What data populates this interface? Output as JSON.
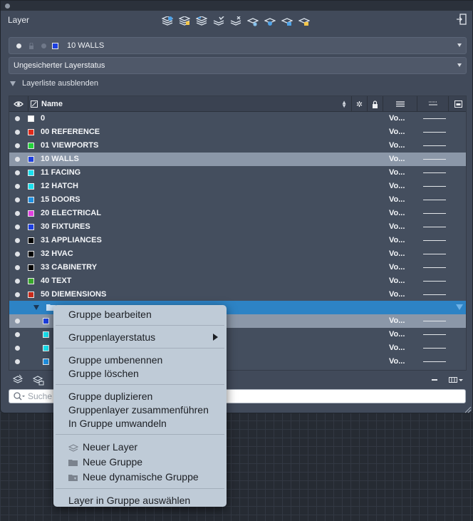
{
  "palette": {
    "title": "Layer",
    "toolbar_icons": [
      "new-layer-icon",
      "new-layer-vp-freeze-icon",
      "delete-layer-icon",
      "set-current-icon",
      "layer-states-icon",
      "freeze-icon",
      "isolate-icon",
      "lock-icon",
      "unlock-icon"
    ],
    "current_layer": "10 WALLS",
    "current_layer_color": "#1d3fe0",
    "layer_state": "Ungesicherter Layerstatus",
    "hide_list_label": "Layerliste ausblenden"
  },
  "table": {
    "header_name": "Name",
    "rows": [
      {
        "name": "0",
        "color": "#ffffff",
        "vo": "Vo..."
      },
      {
        "name": "00 REFERENCE",
        "color": "#e02a1a",
        "vo": "Vo..."
      },
      {
        "name": "01 VIEWPORTS",
        "color": "#22d43a",
        "vo": "Vo..."
      },
      {
        "name": "10 WALLS",
        "color": "#1d3fe0",
        "vo": "Vo...",
        "selected": true
      },
      {
        "name": "11 FACING",
        "color": "#18e0ee",
        "vo": "Vo..."
      },
      {
        "name": "12 HATCH",
        "color": "#18e0ee",
        "vo": "Vo..."
      },
      {
        "name": "15 DOORS",
        "color": "#1e8fe0",
        "vo": "Vo..."
      },
      {
        "name": "20 ELECTRICAL",
        "color": "#e040e0",
        "vo": "Vo..."
      },
      {
        "name": "30 FIXTURES",
        "color": "#1d3fe0",
        "vo": "Vo..."
      },
      {
        "name": "31 APPLIANCES",
        "color": "#000000",
        "vo": "Vo..."
      },
      {
        "name": "32 HVAC",
        "color": "#000000",
        "vo": "Vo..."
      },
      {
        "name": "33 CABINETRY",
        "color": "#000000",
        "vo": "Vo..."
      },
      {
        "name": "40 TEXT",
        "color": "#38a82a",
        "vo": "Vo..."
      },
      {
        "name": "50 DIEMENSIONS",
        "color": "#c82a1a",
        "vo": "Vo..."
      }
    ],
    "sub_rows": [
      {
        "color": "#1d3fe0",
        "vo": "Vo...",
        "selected": true
      },
      {
        "color": "#18e0ee",
        "vo": "Vo..."
      },
      {
        "color": "#18e0ee",
        "vo": "Vo..."
      },
      {
        "color": "#1e8fe0",
        "vo": "Vo..."
      }
    ]
  },
  "search": {
    "placeholder": "Suche"
  },
  "context_menu": {
    "items": {
      "edit_group": "Gruppe bearbeiten",
      "group_layer_state": "Gruppenlayerstatus",
      "rename_group": "Gruppe umbenennen",
      "delete_group": "Gruppe löschen",
      "duplicate_group": "Gruppe duplizieren",
      "merge_group_layers": "Gruppenlayer zusammenführen",
      "convert_to_group": "In Gruppe umwandeln",
      "new_layer": "Neuer Layer",
      "new_group": "Neue Gruppe",
      "new_dynamic_group": "Neue dynamische Gruppe",
      "select_layers_in_group": "Layer in Gruppe auswählen"
    }
  }
}
